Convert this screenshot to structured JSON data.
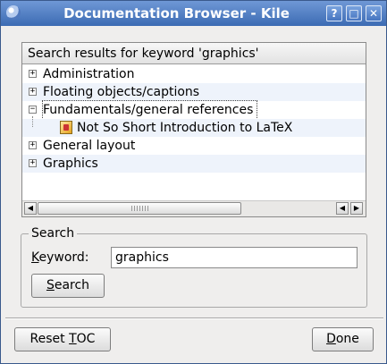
{
  "window": {
    "title": "Documentation Browser - Kile"
  },
  "titlebar_buttons": {
    "help": "?",
    "maximize": "□",
    "close": "✕"
  },
  "results": {
    "header": "Search results for keyword 'graphics'",
    "items": [
      {
        "label": "Administration",
        "expander": "+"
      },
      {
        "label": "Floating objects/captions",
        "expander": "+"
      },
      {
        "label": "Fundamentals/general references",
        "expander": "−"
      },
      {
        "label": "Not So Short Introduction to LaTeX",
        "icon": "document-icon"
      },
      {
        "label": "General layout",
        "expander": "+"
      },
      {
        "label": "Graphics",
        "expander": "+"
      }
    ]
  },
  "search": {
    "group_title": "Search",
    "keyword_label_mnemonic": "K",
    "keyword_label_rest": "eyword:",
    "keyword_value": "graphics",
    "search_button_mnemonic": "S",
    "search_button_rest": "earch"
  },
  "footer": {
    "reset_prefix": "Reset ",
    "reset_mnemonic": "T",
    "reset_rest": "OC",
    "done_mnemonic": "D",
    "done_rest": "one"
  },
  "scrollbar": {
    "left_arrow": "◀",
    "right_arrow_a": "◀",
    "right_arrow_b": "▶"
  }
}
